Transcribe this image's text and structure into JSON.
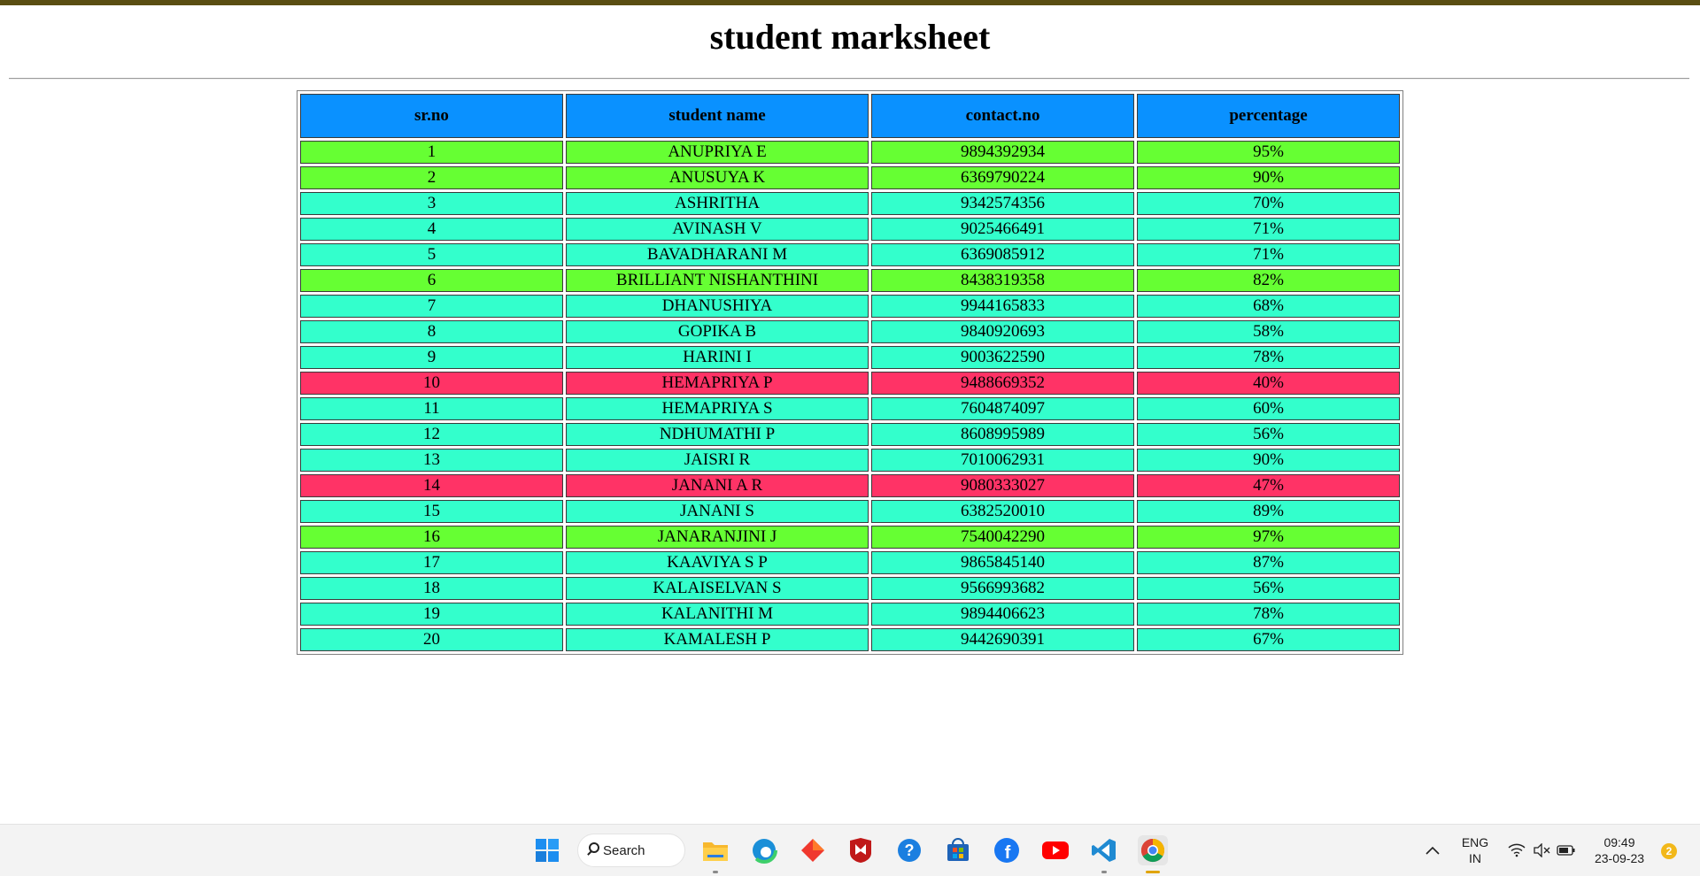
{
  "page": {
    "title": "student marksheet"
  },
  "table": {
    "headers": [
      "sr.no",
      "student name",
      "contact.no",
      "percentage"
    ],
    "rows": [
      {
        "sr": "1",
        "name": "ANUPRIYA E",
        "contact": "9894392934",
        "percentage": "95%",
        "color": "green"
      },
      {
        "sr": "2",
        "name": "ANUSUYA K",
        "contact": "6369790224",
        "percentage": "90%",
        "color": "green"
      },
      {
        "sr": "3",
        "name": "ASHRITHA",
        "contact": "9342574356",
        "percentage": "70%",
        "color": "teal"
      },
      {
        "sr": "4",
        "name": "AVINASH V",
        "contact": "9025466491",
        "percentage": "71%",
        "color": "teal"
      },
      {
        "sr": "5",
        "name": "BAVADHARANI M",
        "contact": "6369085912",
        "percentage": "71%",
        "color": "teal"
      },
      {
        "sr": "6",
        "name": "BRILLIANT NISHANTHINI",
        "contact": "8438319358",
        "percentage": "82%",
        "color": "green"
      },
      {
        "sr": "7",
        "name": "DHANUSHIYA",
        "contact": "9944165833",
        "percentage": "68%",
        "color": "teal"
      },
      {
        "sr": "8",
        "name": "GOPIKA B",
        "contact": "9840920693",
        "percentage": "58%",
        "color": "teal"
      },
      {
        "sr": "9",
        "name": "HARINI I",
        "contact": "9003622590",
        "percentage": "78%",
        "color": "teal"
      },
      {
        "sr": "10",
        "name": "HEMAPRIYA P",
        "contact": "9488669352",
        "percentage": "40%",
        "color": "red"
      },
      {
        "sr": "11",
        "name": "HEMAPRIYA S",
        "contact": "7604874097",
        "percentage": "60%",
        "color": "teal"
      },
      {
        "sr": "12",
        "name": "NDHUMATHI P",
        "contact": "8608995989",
        "percentage": "56%",
        "color": "teal"
      },
      {
        "sr": "13",
        "name": "JAISRI R",
        "contact": "7010062931",
        "percentage": "90%",
        "color": "teal"
      },
      {
        "sr": "14",
        "name": "JANANI A R",
        "contact": "9080333027",
        "percentage": "47%",
        "color": "red"
      },
      {
        "sr": "15",
        "name": "JANANI S",
        "contact": "6382520010",
        "percentage": "89%",
        "color": "teal"
      },
      {
        "sr": "16",
        "name": "JANARANJINI J",
        "contact": "7540042290",
        "percentage": "97%",
        "color": "green"
      },
      {
        "sr": "17",
        "name": "KAAVIYA S P",
        "contact": "9865845140",
        "percentage": "87%",
        "color": "teal"
      },
      {
        "sr": "18",
        "name": "KALAISELVAN S",
        "contact": "9566993682",
        "percentage": "56%",
        "color": "teal"
      },
      {
        "sr": "19",
        "name": "KALANITHI M",
        "contact": "9894406623",
        "percentage": "78%",
        "color": "teal"
      },
      {
        "sr": "20",
        "name": "KAMALESH P",
        "contact": "9442690391",
        "percentage": "67%",
        "color": "teal"
      }
    ]
  },
  "colors": {
    "header": "#0a91ff",
    "green": "#66ff33",
    "teal": "#33ffcc",
    "red": "#ff3366"
  },
  "taskbar": {
    "search_label": "Search",
    "apps": [
      "windows-start-icon",
      "file-explorer-icon",
      "edge-icon",
      "red-diamond-app-icon",
      "mcafee-icon",
      "help-icon",
      "microsoft-store-icon",
      "facebook-icon",
      "youtube-icon",
      "vscode-icon",
      "chrome-icon"
    ],
    "language_top": "ENG",
    "language_bottom": "IN",
    "time": "09:49",
    "date": "23-09-23",
    "notification_count": "2"
  }
}
